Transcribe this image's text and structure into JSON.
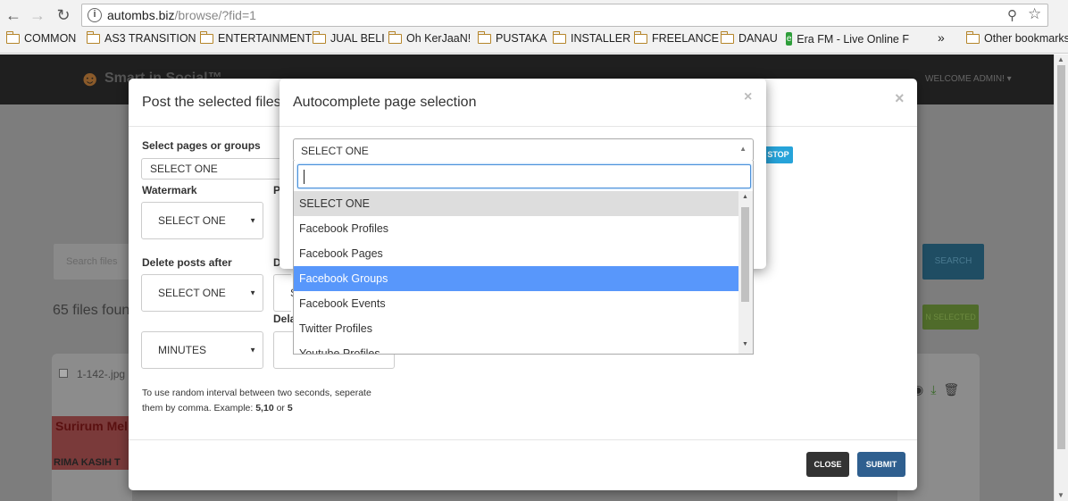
{
  "browser": {
    "url_host": "autombs.biz",
    "url_path": "/browse/?fid=1",
    "bookmarks": [
      "COMMON",
      "AS3 TRANSITION",
      "ENTERTAINMENT",
      "JUAL BELI",
      "Oh KerJaaN!",
      "PUSTAKA",
      "INSTALLER",
      "FREELANCE",
      "DANAU",
      "Era FM - Live Online F"
    ],
    "overflow": "»",
    "other_bookmarks": "Other bookmarks"
  },
  "page": {
    "logo_text": "Smart in Social™",
    "welcome": "WELCOME ADMIN! ▾",
    "search_placeholder": "Search files",
    "search_button": "SEARCH",
    "files_found": "65 files found",
    "selected_button": "N SELECTED",
    "card_filename": "1-142-.jpg",
    "banner_text": "Surirum Mel",
    "banner_text2": "RIMA KASIH T"
  },
  "modal": {
    "title": "Post the selected files",
    "close_x": "×",
    "select_pages_label": "Select pages or groups",
    "select_pages_value": "SELECT ONE",
    "watermark_label": "Watermark",
    "watermark_value": "SELECT ONE",
    "p_label": "P",
    "delete_after_label": "Delete posts after",
    "delete_after_value": "SELECT ONE",
    "d_label": "D",
    "s_value": "S",
    "delay_label": "Dela",
    "minutes_value": "MINUTES",
    "stop_button": "STOP",
    "note_prefix": "To use random interval between two seconds, seperate them by comma. Example: ",
    "note_example1": "5,10",
    "note_or": " or ",
    "note_example2": "5",
    "close_button": "CLOSE",
    "submit_button": "SUBMIT"
  },
  "autocomplete": {
    "title": "Autocomplete page selection",
    "close_x": "×",
    "selected_value": "SELECT ONE",
    "search_value": "",
    "options": [
      {
        "label": "SELECT ONE",
        "state": "hover"
      },
      {
        "label": "Facebook Profiles",
        "state": ""
      },
      {
        "label": "Facebook Pages",
        "state": ""
      },
      {
        "label": "Facebook Groups",
        "state": "active"
      },
      {
        "label": "Facebook Events",
        "state": ""
      },
      {
        "label": "Twitter Profiles",
        "state": ""
      },
      {
        "label": "Youtube Profiles",
        "state": ""
      }
    ]
  }
}
